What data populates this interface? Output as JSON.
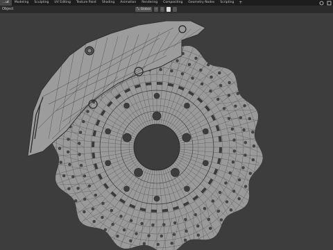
{
  "workspace_tabs": [
    "...ut",
    "Modeling",
    "Sculpting",
    "UV Editing",
    "Texture Paint",
    "Shading",
    "Animation",
    "Rendering",
    "Compositing",
    "Geometry Nodes",
    "Scripting"
  ],
  "active_tab_index": 0,
  "add_tab_label": "+",
  "header": {
    "mode_label": "Object",
    "transform_orientation": "Global",
    "pivot_label": "⁘",
    "snap_label": "∴"
  },
  "colors": {
    "viewport_bg": "#3d3d3d",
    "mesh_fill": "#9a9a9a",
    "wire": "#3a3a3a",
    "accent": "#e87d0d"
  },
  "icons": [
    "blender-menu-icon",
    "transform-orientation-icon",
    "snap-icon",
    "proportional-icon",
    "scene-icon",
    "view-layer-icon"
  ]
}
